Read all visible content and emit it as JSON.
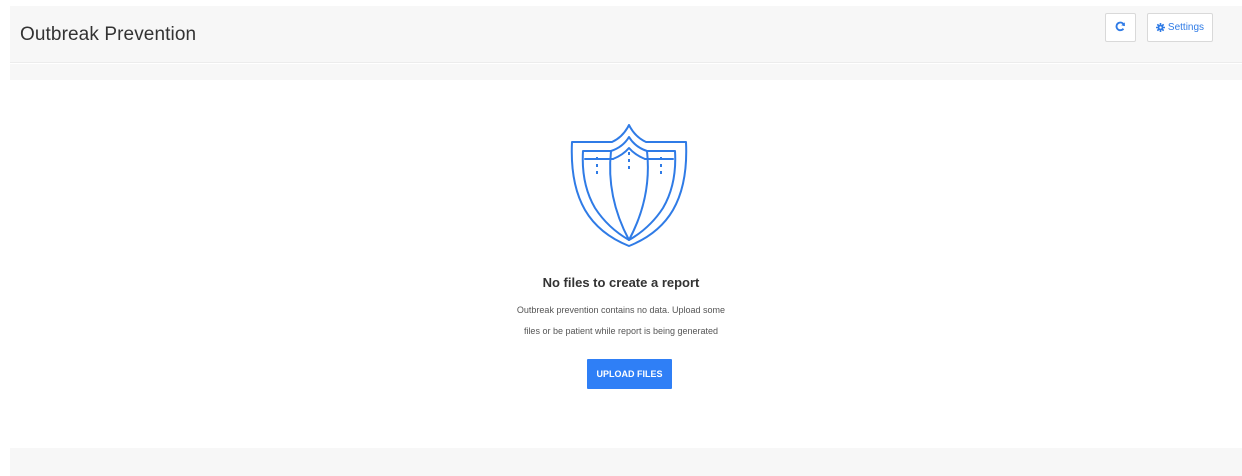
{
  "header": {
    "title": "Outbreak Prevention",
    "refresh_icon": "refresh-icon",
    "settings_label": "Settings",
    "settings_icon": "gear-icon"
  },
  "empty_state": {
    "icon": "shield-icon",
    "title": "No files to create a report",
    "message_line1": "Outbreak prevention contains no data. Upload some",
    "message_line2": "files or be patient while report is being generated",
    "upload_label": "UPLOAD FILES"
  },
  "colors": {
    "accent": "#2f7ff6",
    "header_bg": "#f7f7f7",
    "icon_stroke": "#2f7be6"
  }
}
